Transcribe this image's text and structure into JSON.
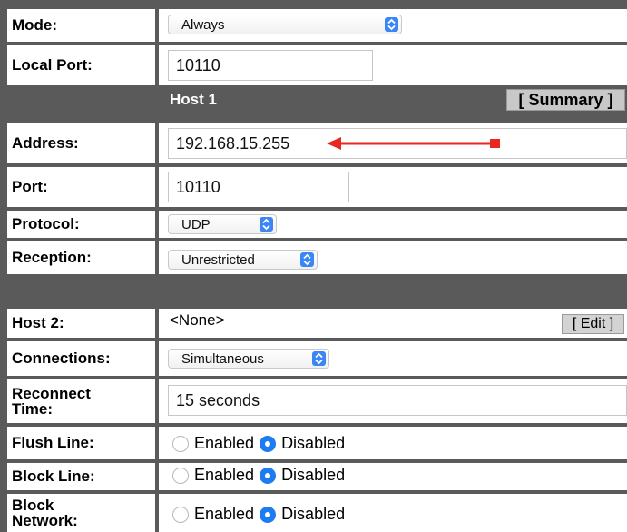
{
  "rows": {
    "mode": {
      "label": "Mode:",
      "value": "Always"
    },
    "local_port": {
      "label": "Local Port:",
      "value": "10110"
    },
    "host1_header": {
      "title": "Host 1",
      "summary_button": "[ Summary ]"
    },
    "address": {
      "label": "Address:",
      "value": "192.168.15.255"
    },
    "port": {
      "label": "Port:",
      "value": "10110"
    },
    "protocol": {
      "label": "Protocol:",
      "value": "UDP"
    },
    "reception": {
      "label": "Reception:",
      "value": "Unrestricted"
    },
    "host2": {
      "label": "Host 2:",
      "value": "<None>",
      "edit_button": "[ Edit ]"
    },
    "connections": {
      "label": "Connections:",
      "value": "Simultaneous"
    },
    "reconnect_time": {
      "label_line1": "Reconnect",
      "label_line2": "Time:",
      "value": "15 seconds"
    },
    "flush_line": {
      "label": "Flush Line:",
      "option1": "Enabled",
      "option2": "Disabled",
      "selected": "Disabled"
    },
    "block_line": {
      "label": "Block Line:",
      "option1": "Enabled",
      "option2": "Disabled",
      "selected": "Disabled"
    },
    "block_network": {
      "label_line1": "Block",
      "label_line2": "Network:",
      "option1": "Enabled",
      "option2": "Disabled",
      "selected": "Disabled"
    }
  },
  "colors": {
    "band": "#5a5a5a",
    "select_arrow": "#3b86f7",
    "radio_selected": "#1d7cf2",
    "annotation_arrow": "#e8281e"
  }
}
